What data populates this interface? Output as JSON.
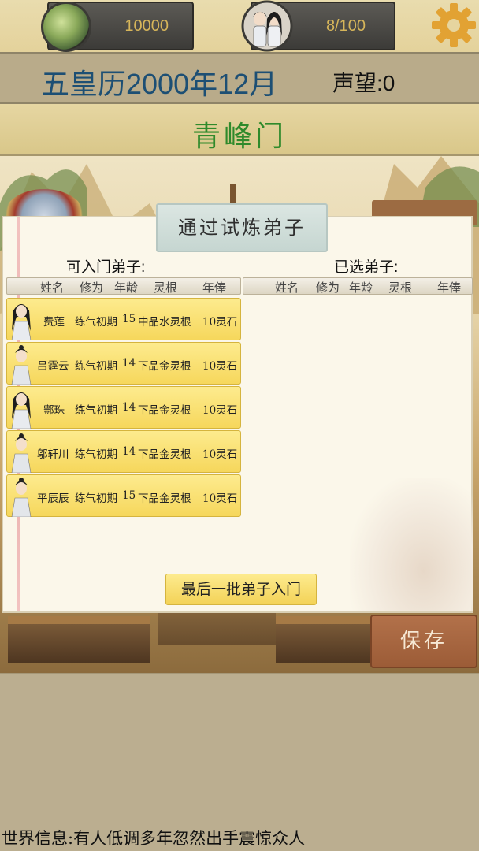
{
  "resources": {
    "spirit_stones": "10000",
    "disciples": "8/100"
  },
  "header": {
    "date": "五皇历2000年12月",
    "fame": "声望:0",
    "sect_name": "青峰门"
  },
  "dialog": {
    "title": "通过试炼弟子",
    "available_label": "可入门弟子:",
    "selected_label": "已选弟子:",
    "columns": [
      "姓名",
      "修为",
      "年龄",
      "灵根",
      "年俸"
    ],
    "disciples": [
      {
        "name": "费莲",
        "cultivation": "练气初期",
        "age": "15",
        "root": "中品水灵根",
        "salary": "10灵石",
        "gender": "female"
      },
      {
        "name": "吕霆云",
        "cultivation": "练气初期",
        "age": "14",
        "root": "下品金灵根",
        "salary": "10灵石",
        "gender": "male"
      },
      {
        "name": "鄷珠",
        "cultivation": "练气初期",
        "age": "14",
        "root": "下品金灵根",
        "salary": "10灵石",
        "gender": "female"
      },
      {
        "name": "邬轩川",
        "cultivation": "练气初期",
        "age": "14",
        "root": "下品金灵根",
        "salary": "10灵石",
        "gender": "male"
      },
      {
        "name": "平辰辰",
        "cultivation": "练气初期",
        "age": "15",
        "root": "下品金灵根",
        "salary": "10灵石",
        "gender": "male"
      }
    ],
    "last_batch_button": "最后一批弟子入门"
  },
  "save_button": "保存",
  "world_news": "世界信息:有人低调多年忽然出手震惊众人",
  "icons": {
    "spirit_stone": "spirit-stone-icon",
    "disciples": "disciple-pair-icon",
    "settings": "gear-icon"
  },
  "colors": {
    "date": "#1d4f74",
    "sect_name": "#2f8a2b",
    "row_fill": "#f6d75c",
    "save_button": "#a3613b"
  }
}
